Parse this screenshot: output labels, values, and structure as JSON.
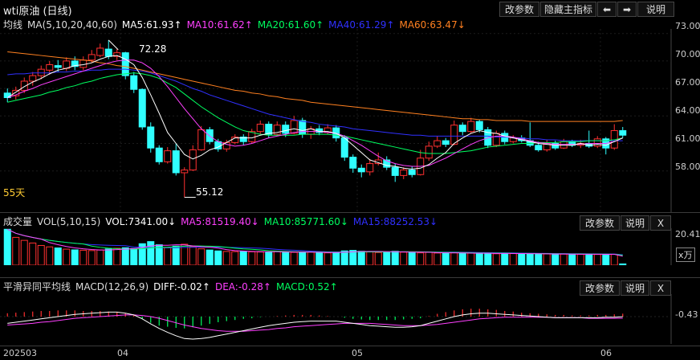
{
  "colors": {
    "ma5": "#ffffff",
    "ma10": "#ff40ff",
    "ma20": "#00ff60",
    "ma40": "#3030ff",
    "ma60": "#ff8020",
    "up": "#ff3030",
    "down": "#30ffff"
  },
  "top": {
    "title": "wti原油 (日线)",
    "buttons": [
      "改参数",
      "隐藏主指标",
      "⬅",
      "➡",
      "说明"
    ]
  },
  "main": {
    "indicator_name": "均线",
    "indicator_params": "MA(5,10,20,40,60)",
    "ma5": "MA5:61.93↑",
    "ma10": "MA10:61.62↑",
    "ma20": "MA20:61.60↑",
    "ma40": "MA40:61.29↑",
    "ma60": "MA60:63.47↓",
    "y_ticks": [
      "73.00",
      "70.00",
      "67.00",
      "64.00",
      "61.00",
      "58.00"
    ],
    "high_label": "72.28",
    "low_label": "55.12",
    "period_label": "55天"
  },
  "vol": {
    "title": "成交量",
    "params": "VOL(5,10,15)",
    "vol": "VOL:7341.00↓",
    "ma5": "MA5:81519.40↓",
    "ma10": "MA10:85771.60↓",
    "ma15": "MA15:88252.53↓",
    "buttons": [
      "改参数",
      "说明",
      "X"
    ],
    "y_tick": "20.41",
    "unit": "x万"
  },
  "macd": {
    "title": "平滑异同平均线",
    "params": "MACD(12,26,9)",
    "diff": "DIFF:-0.02↑",
    "dea": "DEA:-0.28↑",
    "macd": "MACD:0.52↑",
    "buttons": [
      "改参数",
      "说明",
      "X"
    ],
    "y_tick": "-0.43"
  },
  "x_ticks": [
    "202503",
    "04",
    "05",
    "06"
  ],
  "chart_data": {
    "type": "candlestick",
    "candles": [
      [
        66.5,
        66.0,
        67.0,
        65.5
      ],
      [
        66.2,
        66.8,
        67.2,
        65.8
      ],
      [
        66.8,
        67.8,
        68.2,
        66.5
      ],
      [
        67.8,
        68.4,
        68.8,
        67.3
      ],
      [
        68.4,
        69.1,
        69.5,
        68.0
      ],
      [
        69.0,
        69.6,
        70.0,
        68.5
      ],
      [
        69.5,
        69.3,
        70.1,
        68.8
      ],
      [
        69.2,
        70.0,
        70.4,
        68.9
      ],
      [
        70.0,
        69.4,
        70.5,
        69.0
      ],
      [
        69.3,
        70.1,
        70.5,
        69.0
      ],
      [
        70.1,
        70.7,
        71.2,
        69.8
      ],
      [
        70.6,
        71.4,
        71.9,
        70.4
      ],
      [
        71.3,
        70.5,
        72.28,
        70.2
      ],
      [
        70.5,
        70.9,
        71.3,
        70.1
      ],
      [
        70.9,
        68.4,
        71.0,
        68.0
      ],
      [
        68.4,
        66.9,
        68.8,
        66.5
      ],
      [
        66.9,
        62.8,
        67.0,
        62.5
      ],
      [
        62.8,
        60.5,
        63.3,
        60.0
      ],
      [
        60.5,
        59.0,
        60.8,
        58.7
      ],
      [
        59.0,
        60.2,
        60.6,
        58.8
      ],
      [
        60.2,
        57.8,
        61.0,
        57.5
      ],
      [
        57.8,
        58.1,
        58.4,
        55.12
      ],
      [
        58.1,
        60.3,
        60.8,
        58.0
      ],
      [
        60.3,
        62.5,
        62.9,
        60.2
      ],
      [
        62.5,
        61.2,
        62.8,
        60.9
      ],
      [
        61.2,
        60.4,
        61.5,
        60.1
      ],
      [
        60.4,
        61.1,
        61.4,
        60.1
      ],
      [
        61.1,
        61.7,
        62.0,
        60.9
      ],
      [
        61.7,
        61.2,
        62.0,
        60.8
      ],
      [
        61.2,
        62.3,
        62.6,
        61.0
      ],
      [
        62.3,
        63.1,
        63.5,
        62.0
      ],
      [
        63.1,
        62.0,
        63.4,
        61.6
      ],
      [
        62.0,
        63.0,
        63.4,
        61.8
      ],
      [
        63.0,
        62.1,
        63.4,
        61.7
      ],
      [
        62.1,
        63.5,
        64.0,
        62.0
      ],
      [
        63.5,
        62.0,
        63.8,
        61.6
      ],
      [
        62.0,
        62.6,
        62.9,
        61.5
      ],
      [
        62.6,
        62.2,
        63.0,
        61.9
      ],
      [
        62.2,
        62.7,
        63.1,
        62.0
      ],
      [
        62.7,
        61.6,
        63.0,
        61.2
      ],
      [
        61.6,
        59.5,
        61.9,
        59.1
      ],
      [
        59.5,
        58.3,
        59.8,
        57.8
      ],
      [
        58.3,
        57.9,
        58.7,
        57.3
      ],
      [
        57.9,
        58.8,
        59.3,
        57.5
      ],
      [
        58.8,
        59.2,
        60.0,
        58.6
      ],
      [
        59.2,
        58.4,
        59.6,
        58.1
      ],
      [
        58.4,
        57.5,
        58.8,
        56.8
      ],
      [
        57.5,
        58.1,
        58.4,
        57.1
      ],
      [
        58.1,
        57.6,
        58.5,
        57.3
      ],
      [
        57.6,
        59.4,
        60.3,
        57.5
      ],
      [
        59.4,
        60.7,
        61.2,
        59.1
      ],
      [
        60.7,
        61.3,
        61.8,
        60.5
      ],
      [
        61.3,
        60.9,
        61.6,
        60.6
      ],
      [
        60.9,
        63.0,
        63.5,
        60.8
      ],
      [
        63.0,
        62.3,
        63.3,
        61.9
      ],
      [
        62.3,
        63.4,
        63.8,
        62.1
      ],
      [
        63.4,
        62.5,
        63.6,
        62.2
      ],
      [
        62.5,
        60.8,
        62.8,
        60.5
      ],
      [
        60.8,
        62.1,
        62.4,
        60.6
      ],
      [
        62.1,
        61.2,
        62.4,
        60.9
      ],
      [
        61.2,
        61.6,
        61.9,
        61.0
      ],
      [
        61.6,
        61.3,
        61.9,
        61.1
      ],
      [
        61.3,
        60.8,
        63.3,
        60.6
      ],
      [
        60.8,
        60.3,
        61.2,
        60.1
      ],
      [
        60.3,
        61.0,
        61.4,
        60.1
      ],
      [
        61.0,
        60.5,
        61.3,
        60.3
      ],
      [
        60.5,
        61.2,
        61.5,
        60.4
      ],
      [
        61.2,
        60.8,
        61.4,
        60.6
      ],
      [
        60.8,
        61.0,
        61.4,
        60.5
      ],
      [
        61.0,
        60.7,
        62.4,
        60.5
      ],
      [
        60.7,
        61.5,
        61.8,
        60.5
      ],
      [
        61.5,
        60.5,
        61.7,
        59.8
      ],
      [
        60.5,
        62.4,
        63.1,
        60.3
      ],
      [
        62.4,
        61.9,
        62.8,
        61.6
      ]
    ],
    "ma5": [
      66.0,
      66.6,
      67.2,
      67.7,
      68.1,
      68.6,
      69.0,
      69.2,
      69.5,
      69.6,
      69.8,
      70.2,
      70.5,
      70.6,
      70.2,
      69.6,
      68.2,
      66.3,
      64.3,
      62.2,
      61.0,
      59.8,
      59.3,
      59.7,
      60.3,
      60.6,
      61.1,
      61.6,
      61.6,
      61.6,
      61.9,
      62.1,
      62.2,
      62.4,
      62.6,
      62.4,
      62.6,
      62.3,
      62.3,
      62.1,
      61.6,
      60.8,
      60.0,
      59.2,
      58.9,
      58.6,
      58.5,
      58.3,
      58.2,
      58.3,
      58.7,
      59.4,
      60.0,
      61.0,
      61.6,
      62.1,
      62.4,
      62.2,
      62.1,
      61.8,
      61.6,
      61.4,
      61.2,
      61.0,
      60.9,
      60.8,
      60.8,
      60.8,
      61.0,
      60.8,
      60.9,
      60.8,
      61.2,
      61.6
    ],
    "ma10": [
      66.0,
      66.3,
      66.7,
      67.0,
      67.4,
      67.7,
      68.0,
      68.3,
      68.6,
      68.9,
      69.2,
      69.5,
      69.8,
      70.0,
      70.1,
      70.1,
      69.8,
      69.2,
      68.3,
      67.2,
      66.0,
      64.8,
      63.7,
      62.6,
      61.8,
      61.2,
      60.9,
      60.7,
      60.8,
      61.0,
      61.3,
      61.6,
      61.8,
      62.0,
      62.2,
      62.3,
      62.3,
      62.3,
      62.2,
      62.1,
      61.8,
      61.3,
      60.8,
      60.2,
      59.6,
      59.1,
      58.8,
      58.6,
      58.5,
      58.5,
      58.6,
      59.0,
      59.4,
      59.9,
      60.4,
      60.9,
      61.3,
      61.6,
      61.8,
      61.8,
      61.7,
      61.5,
      61.3,
      61.1,
      61.0,
      60.9,
      60.9,
      60.9,
      60.9,
      61.0,
      61.0,
      61.0,
      61.2,
      61.6
    ],
    "ma20": [
      65.5,
      65.7,
      65.9,
      66.1,
      66.3,
      66.6,
      66.8,
      67.1,
      67.3,
      67.6,
      67.8,
      68.1,
      68.3,
      68.5,
      68.6,
      68.7,
      68.6,
      68.4,
      68.1,
      67.6,
      67.1,
      66.4,
      65.7,
      65.0,
      64.4,
      63.8,
      63.3,
      62.8,
      62.4,
      62.2,
      62.0,
      61.9,
      61.9,
      61.9,
      61.9,
      62.0,
      62.0,
      62.0,
      62.0,
      61.9,
      61.8,
      61.6,
      61.4,
      61.2,
      61.0,
      60.8,
      60.6,
      60.4,
      60.2,
      60.0,
      59.9,
      59.9,
      59.9,
      60.0,
      60.1,
      60.2,
      60.4,
      60.6,
      60.7,
      60.8,
      60.9,
      61.0,
      61.0,
      61.1,
      61.1,
      61.1,
      61.2,
      61.2,
      61.2,
      61.3,
      61.3,
      61.3,
      61.4,
      61.6
    ],
    "ma40": [
      68.5,
      68.6,
      68.6,
      68.7,
      68.7,
      68.7,
      68.8,
      68.8,
      68.9,
      68.9,
      69.0,
      69.0,
      69.1,
      69.1,
      69.1,
      69.0,
      68.9,
      68.7,
      68.4,
      68.1,
      67.8,
      67.4,
      67.0,
      66.7,
      66.3,
      66.0,
      65.7,
      65.4,
      65.1,
      64.8,
      64.5,
      64.2,
      64.0,
      63.8,
      63.6,
      63.4,
      63.3,
      63.1,
      63.0,
      62.9,
      62.8,
      62.6,
      62.5,
      62.4,
      62.3,
      62.2,
      62.1,
      62.0,
      61.9,
      61.9,
      61.8,
      61.8,
      61.8,
      61.8,
      61.8,
      61.8,
      61.8,
      61.8,
      61.7,
      61.7,
      61.6,
      61.6,
      61.5,
      61.5,
      61.4,
      61.4,
      61.3,
      61.3,
      61.3,
      61.3,
      61.3,
      61.3,
      61.3,
      61.3
    ],
    "ma60": [
      71.0,
      70.9,
      70.8,
      70.7,
      70.6,
      70.5,
      70.4,
      70.3,
      70.2,
      70.1,
      70.0,
      69.8,
      69.7,
      69.5,
      69.4,
      69.2,
      69.0,
      68.8,
      68.6,
      68.4,
      68.2,
      68.0,
      67.8,
      67.6,
      67.4,
      67.2,
      67.0,
      66.8,
      66.7,
      66.5,
      66.4,
      66.2,
      66.1,
      65.9,
      65.8,
      65.7,
      65.5,
      65.4,
      65.3,
      65.2,
      65.1,
      65.0,
      64.9,
      64.8,
      64.7,
      64.6,
      64.5,
      64.4,
      64.3,
      64.2,
      64.1,
      64.0,
      63.9,
      63.8,
      63.7,
      63.7,
      63.6,
      63.6,
      63.5,
      63.5,
      63.5,
      63.5,
      63.4,
      63.4,
      63.4,
      63.4,
      63.4,
      63.4,
      63.4,
      63.4,
      63.4,
      63.4,
      63.4,
      63.5
    ],
    "volumes": [
      20.41,
      15.8,
      14.1,
      12.6,
      11.2,
      10.4,
      9.8,
      9.1,
      8.7,
      8.5,
      8.3,
      8.6,
      9.2,
      9.6,
      9.9,
      9.5,
      12.2,
      13.4,
      11.6,
      9.9,
      10.8,
      11.9,
      10.5,
      9.3,
      8.6,
      8.1,
      7.8,
      7.7,
      7.9,
      7.6,
      7.5,
      7.4,
      7.8,
      7.5,
      7.3,
      7.2,
      7.4,
      7.1,
      7.0,
      7.3,
      8.1,
      8.4,
      7.9,
      7.5,
      7.2,
      7.6,
      7.9,
      7.4,
      7.1,
      7.0,
      7.3,
      6.9,
      6.8,
      7.0,
      6.7,
      6.9,
      6.6,
      6.8,
      6.5,
      6.7,
      6.6,
      6.4,
      6.5,
      6.3,
      6.4,
      6.2,
      6.3,
      6.1,
      6.2,
      6.4,
      6.1,
      6.0,
      6.2,
      0.73
    ],
    "macd_hist": [
      0.6,
      0.7,
      0.8,
      0.9,
      1.0,
      1.0,
      1.1,
      1.1,
      1.1,
      1.0,
      1.0,
      1.0,
      0.9,
      0.8,
      0.6,
      0.3,
      -0.4,
      -1.1,
      -1.6,
      -1.8,
      -2.0,
      -2.1,
      -1.9,
      -1.6,
      -1.3,
      -1.0,
      -0.8,
      -0.6,
      -0.4,
      -0.3,
      -0.1,
      0.0,
      0.1,
      0.2,
      0.3,
      0.3,
      0.3,
      0.2,
      0.1,
      0.0,
      -0.2,
      -0.4,
      -0.5,
      -0.6,
      -0.6,
      -0.6,
      -0.6,
      -0.5,
      -0.4,
      -0.3,
      0.1,
      0.5,
      0.8,
      1.1,
      1.3,
      1.4,
      1.4,
      1.3,
      1.2,
      1.0,
      0.9,
      0.7,
      0.6,
      0.5,
      0.4,
      0.3,
      0.3,
      0.2,
      0.2,
      0.2,
      0.3,
      0.3,
      0.4,
      0.52
    ],
    "diff": [
      -1.2,
      -1.0,
      -0.8,
      -0.6,
      -0.4,
      -0.2,
      0.0,
      0.2,
      0.4,
      0.5,
      0.6,
      0.7,
      0.8,
      0.8,
      0.6,
      0.3,
      -0.4,
      -1.3,
      -2.1,
      -2.8,
      -3.4,
      -3.9,
      -4.0,
      -3.9,
      -3.7,
      -3.4,
      -3.1,
      -2.8,
      -2.5,
      -2.2,
      -1.9,
      -1.6,
      -1.4,
      -1.2,
      -1.0,
      -0.9,
      -0.8,
      -0.8,
      -0.8,
      -0.8,
      -1.0,
      -1.2,
      -1.4,
      -1.6,
      -1.7,
      -1.8,
      -1.9,
      -1.9,
      -1.8,
      -1.6,
      -1.2,
      -0.8,
      -0.4,
      0.0,
      0.3,
      0.5,
      0.6,
      0.6,
      0.5,
      0.4,
      0.3,
      0.2,
      0.1,
      0.0,
      -0.1,
      -0.2,
      -0.2,
      -0.2,
      -0.2,
      -0.2,
      -0.2,
      -0.1,
      -0.1,
      -0.02
    ],
    "dea": [
      -1.5,
      -1.4,
      -1.3,
      -1.2,
      -1.0,
      -0.9,
      -0.7,
      -0.5,
      -0.3,
      -0.2,
      -0.1,
      0.0,
      0.1,
      0.2,
      0.3,
      0.3,
      0.2,
      0.0,
      -0.3,
      -0.7,
      -1.1,
      -1.5,
      -1.8,
      -2.1,
      -2.3,
      -2.5,
      -2.6,
      -2.6,
      -2.6,
      -2.5,
      -2.4,
      -2.3,
      -2.1,
      -2.0,
      -1.8,
      -1.7,
      -1.6,
      -1.5,
      -1.4,
      -1.3,
      -1.2,
      -1.2,
      -1.2,
      -1.2,
      -1.3,
      -1.4,
      -1.5,
      -1.6,
      -1.6,
      -1.6,
      -1.5,
      -1.4,
      -1.2,
      -1.0,
      -0.8,
      -0.6,
      -0.4,
      -0.3,
      -0.2,
      -0.1,
      -0.1,
      -0.1,
      -0.1,
      -0.1,
      -0.1,
      -0.2,
      -0.2,
      -0.2,
      -0.2,
      -0.3,
      -0.3,
      -0.3,
      -0.3,
      -0.28
    ]
  }
}
